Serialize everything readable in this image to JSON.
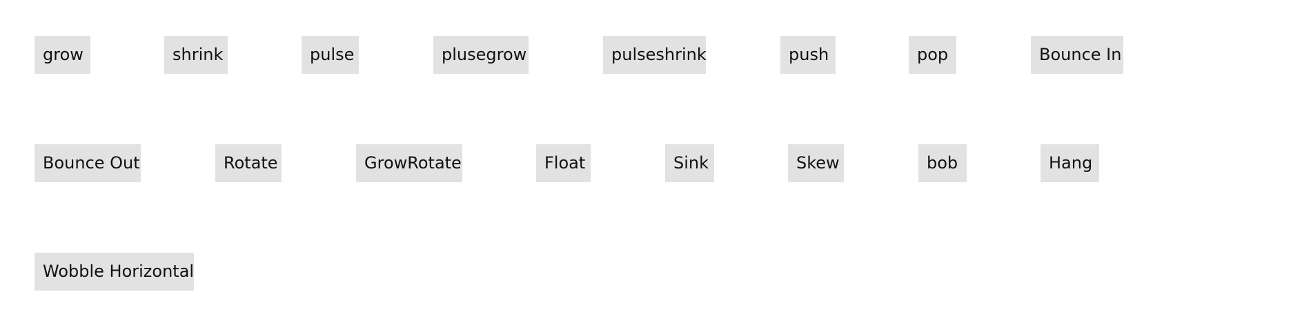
{
  "rows": [
    [
      "grow",
      "shrink",
      "pulse",
      "plusegrow",
      "pulseshrink",
      "push",
      "pop",
      "Bounce In"
    ],
    [
      "Bounce Out",
      "Rotate",
      "GrowRotate",
      "Float",
      "Sink",
      "Skew",
      "bob",
      "Hang"
    ],
    [
      "Wobble Horizontal"
    ]
  ],
  "colors": {
    "button_background": "#e2e2e2",
    "text": "#111111",
    "page_background": "#ffffff"
  }
}
